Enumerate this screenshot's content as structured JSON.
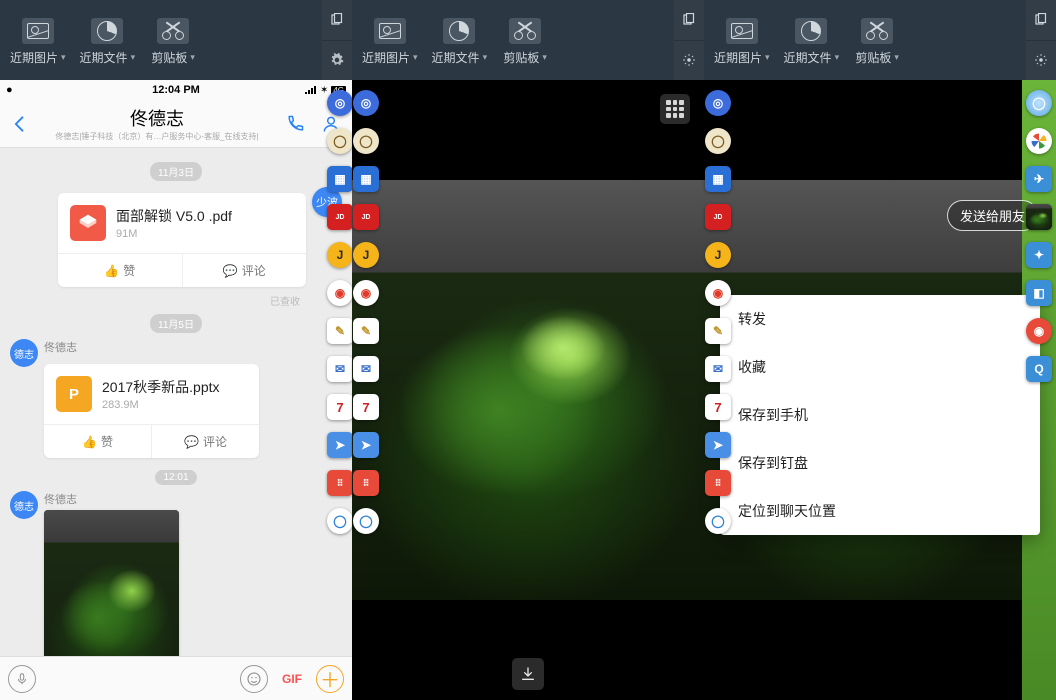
{
  "topbar": {
    "pics": "近期图片",
    "files": "近期文件",
    "clip": "剪贴板"
  },
  "status": {
    "time": "12:04 PM",
    "net_badge": "4G"
  },
  "chat": {
    "title": "佟德志",
    "subtitle": "佟德志|锤子科技（北京）有…户服务中心-客服_在线支持|",
    "date1": "11月3日",
    "date2": "11月5日",
    "time3": "12:01",
    "badge": "少波",
    "avatar": "德志",
    "sender": "佟德志",
    "receipt": "已查收",
    "file1": {
      "name": "面部解锁 V5.0 .pdf",
      "size": "91M"
    },
    "file2": {
      "name": "2017秋季新品.pptx",
      "size": "283.9M"
    },
    "like": "赞",
    "comment": "评论"
  },
  "panel2": {},
  "panel3": {
    "send": "发送给朋友",
    "menu": [
      "转发",
      "收藏",
      "保存到手机",
      "保存到钉盘",
      "定位到聊天位置"
    ]
  }
}
